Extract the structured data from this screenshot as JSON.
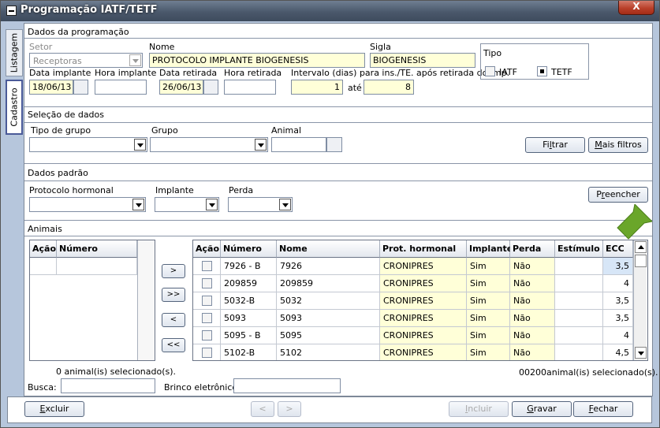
{
  "window": {
    "title": "Programação IATF/TETF",
    "close_label": "X"
  },
  "tabs": [
    {
      "label": "Listagem"
    },
    {
      "label": "Cadastro"
    }
  ],
  "programacao": {
    "section_title": "Dados da programação",
    "setor_label": "Setor",
    "setor_value": "Receptoras",
    "nome_label": "Nome",
    "nome_value": "PROTOCOLO IMPLANTE BIOGENESIS",
    "sigla_label": "Sigla",
    "sigla_value": "BIOGENESIS",
    "data_implante_label": "Data implante",
    "data_implante_value": "18/06/13",
    "hora_implante_label": "Hora implante",
    "hora_implante_value": "",
    "data_retirada_label": "Data retirada",
    "data_retirada_value": "26/06/13",
    "hora_retirada_label": "Hora retirada",
    "hora_retirada_value": "",
    "intervalo_label": "Intervalo (dias) para ins./TE. após retirada do imp.",
    "intervalo_from": "1",
    "ate_label": "até",
    "intervalo_to": "8",
    "tipo_label": "Tipo",
    "tipo_iatf": "IATF",
    "tipo_tetf": "TETF"
  },
  "selecao": {
    "section_title": "Seleção de dados",
    "tipo_grupo_label": "Tipo de grupo",
    "grupo_label": "Grupo",
    "animal_label": "Animal",
    "filtrar_pre": "Fi",
    "filtrar_u": "l",
    "filtrar_post": "trar",
    "mais_u": "M",
    "mais_post": "ais filtros"
  },
  "padrao": {
    "section_title": "Dados padrão",
    "protocolo_label": "Protocolo hormonal",
    "implante_label": "Implante",
    "perda_label": "Perda",
    "preencher_pre": "P",
    "preencher_u": "r",
    "preencher_post": "eencher"
  },
  "animais": {
    "section_title": "Animais",
    "left_headers": [
      "Ação",
      "Número"
    ],
    "right_headers": [
      "Ação",
      "Número",
      "Nome",
      "Prot. hormonal",
      "Implante",
      "Perda",
      "Estímulo",
      "ECC"
    ],
    "rows": [
      {
        "numero": "7926 - B",
        "nome": "7926",
        "prot": "CRONIPRES",
        "implante": "Sim",
        "perda": "Não",
        "estimulo": "",
        "ecc": "3,5"
      },
      {
        "numero": "209859",
        "nome": "209859",
        "prot": "CRONIPRES",
        "implante": "Sim",
        "perda": "Não",
        "estimulo": "",
        "ecc": "4"
      },
      {
        "numero": "5032-B",
        "nome": "5032",
        "prot": "CRONIPRES",
        "implante": "Sim",
        "perda": "Não",
        "estimulo": "",
        "ecc": "3,5"
      },
      {
        "numero": "5093",
        "nome": "5093",
        "prot": "CRONIPRES",
        "implante": "Sim",
        "perda": "Não",
        "estimulo": "",
        "ecc": "3,5"
      },
      {
        "numero": "5095 - B",
        "nome": "5095",
        "prot": "CRONIPRES",
        "implante": "Sim",
        "perda": "Não",
        "estimulo": "",
        "ecc": "4"
      },
      {
        "numero": "5102-B",
        "nome": "5102",
        "prot": "CRONIPRES",
        "implante": "Sim",
        "perda": "Não",
        "estimulo": "",
        "ecc": "4,5"
      }
    ],
    "move_buttons": [
      ">",
      ">>",
      "<",
      "<<"
    ],
    "left_count": "0 animal(is) selecionado(s).",
    "right_count_num": "00200",
    "right_count_text": "animal(is) selecionado(s).",
    "busca_label": "Busca:",
    "busca_value": "",
    "brinco_label": "Brinco eletrônico:",
    "brinco_value": ""
  },
  "footer": {
    "excluir_u": "E",
    "excluir_post": "xcluir",
    "prev": "<",
    "next": ">",
    "incluir_u": "I",
    "incluir_post": "ncluir",
    "gravar_u": "G",
    "gravar_post": "ravar",
    "fechar_u": "F",
    "fechar_post": "echar"
  },
  "colors": {
    "field_yellow": "#ffffd8",
    "titlebar": "#4a586b",
    "close": "#b9402a",
    "arrow_green": "#6aa62a"
  }
}
